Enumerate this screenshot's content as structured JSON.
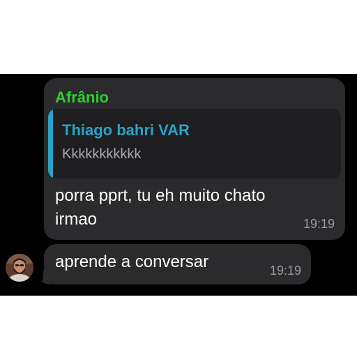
{
  "chat": {
    "messages": [
      {
        "sender": "Afrânio",
        "reply": {
          "author": "Thiago bahri VAR",
          "text": "Kkkkkkkkkkk"
        },
        "text": "porra pprt, tu eh muito chato irmao",
        "time": "19:19"
      },
      {
        "text": "aprende a conversar",
        "time": "19:19"
      }
    ]
  },
  "colors": {
    "sender_name": "#32cd32",
    "quote_accent": "#2aa3c7",
    "bubble": "#2b2b2d",
    "background": "#000000"
  },
  "icons": {
    "avatar": "profile-photo"
  }
}
